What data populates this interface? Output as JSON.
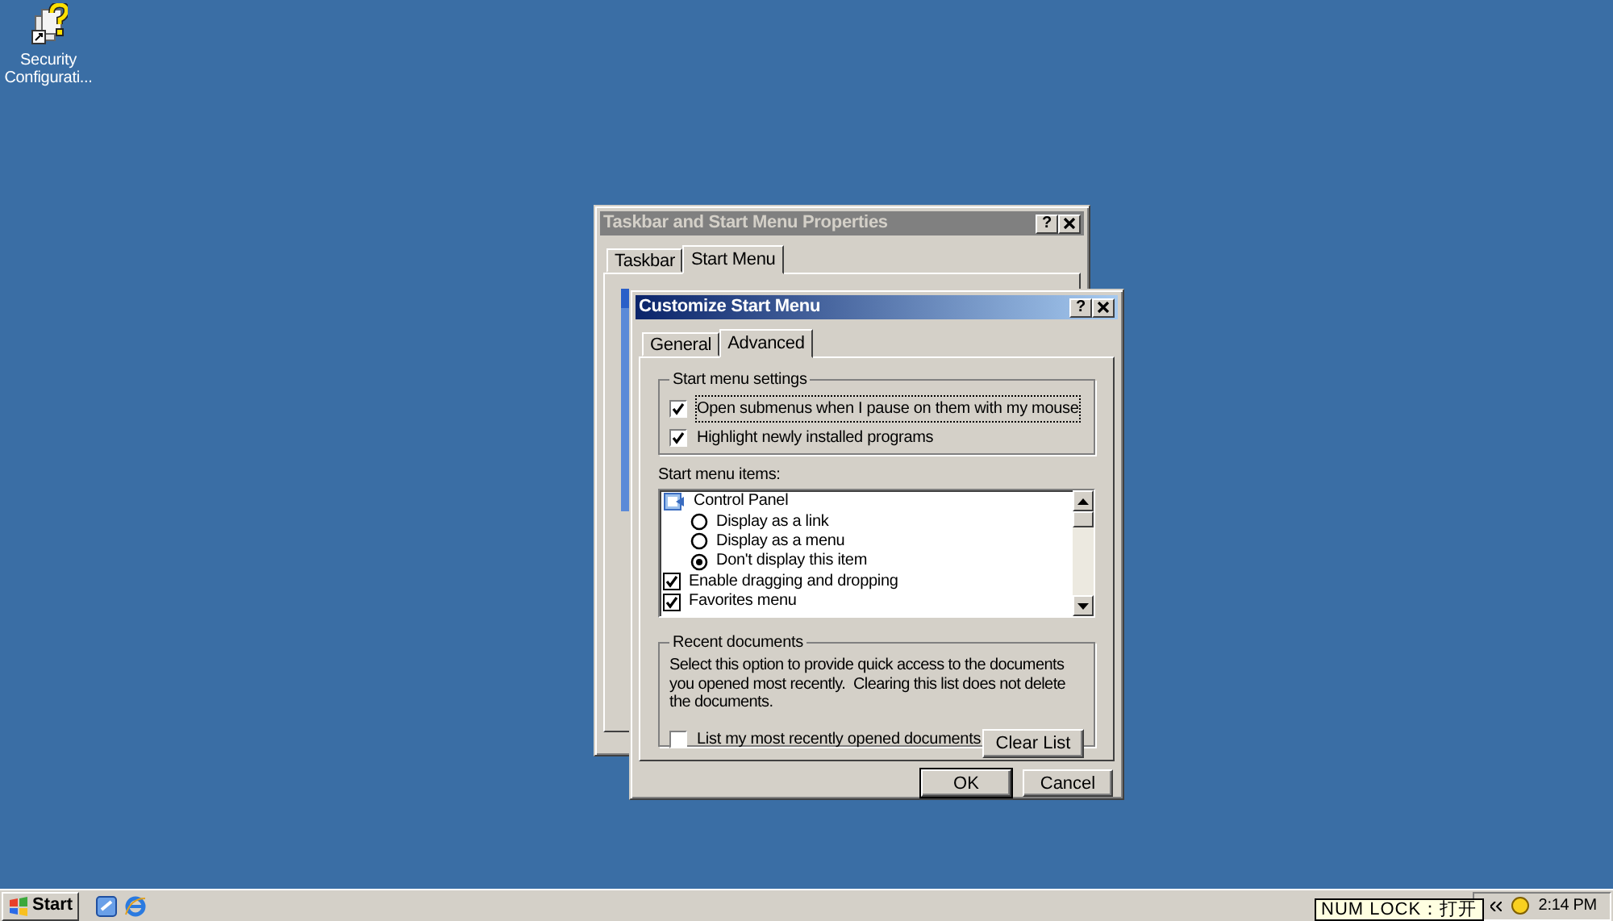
{
  "desktop_icons": [
    {
      "label": "Security Configurati..."
    }
  ],
  "back_window": {
    "title": "Taskbar and Start Menu Properties",
    "help_button": "?",
    "tabs": [
      {
        "label": "Taskbar",
        "selected": false
      },
      {
        "label": "Start Menu",
        "selected": true
      }
    ]
  },
  "dialog": {
    "title": "Customize Start Menu",
    "help_button": "?",
    "tabs": [
      {
        "label": "General",
        "selected": false
      },
      {
        "label": "Advanced",
        "selected": true
      }
    ],
    "settings_group": {
      "title": "Start menu settings",
      "options": [
        {
          "label": "Open submenus when I pause on them with my mouse",
          "checked": true,
          "focused": true
        },
        {
          "label": "Highlight newly installed programs",
          "checked": true,
          "focused": false
        }
      ]
    },
    "items_label": "Start menu items:",
    "items": [
      {
        "kind": "group",
        "label": "Control Panel",
        "children": [
          {
            "kind": "radio",
            "label": "Display as a link",
            "selected": false
          },
          {
            "kind": "radio",
            "label": "Display as a menu",
            "selected": false
          },
          {
            "kind": "radio",
            "label": "Don't display this item",
            "selected": true
          }
        ]
      },
      {
        "kind": "checkbox",
        "label": "Enable dragging and dropping",
        "checked": true
      },
      {
        "kind": "checkbox",
        "label": "Favorites menu",
        "checked": true
      }
    ],
    "recent_group": {
      "title": "Recent documents",
      "description": "Select this option to provide quick access to the documents you opened most recently.  Clearing this list does not delete the documents.",
      "option": {
        "label": "List my most recently opened documents",
        "checked": false
      },
      "clear_button": "Clear List"
    },
    "buttons": [
      {
        "label": "OK",
        "default": true
      },
      {
        "label": "Cancel",
        "default": false
      }
    ]
  },
  "taskbar": {
    "start_label": "Start",
    "clock": "2:14 PM",
    "tooltip": "NUM LOCK：打开"
  }
}
